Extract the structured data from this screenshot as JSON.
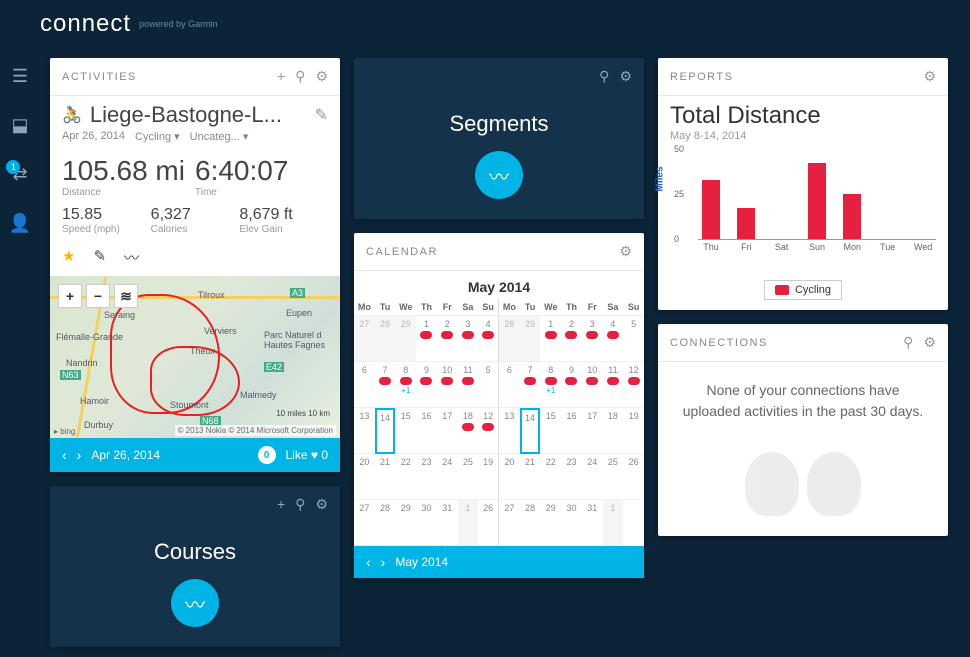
{
  "brand": {
    "name": "connect",
    "sub": "powered by Garmin"
  },
  "sidebar": {
    "notif_count": "1"
  },
  "activities": {
    "header": "ACTIVITIES",
    "title": "Liege-Bastogne-L...",
    "date": "Apr 26, 2014",
    "sport": "Cycling",
    "category": "Uncateg...",
    "distance_val": "105.68 mi",
    "distance_lbl": "Distance",
    "time_val": "6:40:07",
    "time_lbl": "Time",
    "speed_val": "15.85",
    "speed_lbl": "Speed (mph)",
    "cal_val": "6,327",
    "cal_lbl": "Calories",
    "elev_val": "8,679 ft",
    "elev_lbl": "Elev Gain",
    "map": {
      "places": [
        "Seraing",
        "Flémalle-Grande",
        "Verviers",
        "Theux",
        "Nandrin",
        "Hamoir",
        "Durbuy",
        "Stoumont",
        "Malmedy",
        "Tilroux",
        "Eupen",
        "Parc Naturel d Hautes Fagnes",
        "N63",
        "A3",
        "N68",
        "E42"
      ],
      "scale": "10 miles   10 km",
      "attr1": "© 2013 Nokia",
      "attr2": "© 2014 Microsoft Corporation",
      "bing": "bing"
    },
    "footer_date": "Apr 26, 2014",
    "footer_comments": "0",
    "footer_like": "Like",
    "footer_likes": "0"
  },
  "segments": {
    "header": "Segments"
  },
  "courses": {
    "header": "Courses"
  },
  "calendar": {
    "header": "CALENDAR",
    "title": "May 2014",
    "dayheads": [
      "Mo",
      "Tu",
      "We",
      "Th",
      "Fr",
      "Sa",
      "Su",
      "Mo",
      "Tu",
      "We",
      "Th",
      "Fr",
      "Sa",
      "Su"
    ],
    "rows": [
      [
        {
          "d": "27",
          "g": true
        },
        {
          "d": "28",
          "g": true
        },
        {
          "d": "29",
          "g": true
        },
        {
          "d": "1",
          "dot": true
        },
        {
          "d": "2",
          "dot": true
        },
        {
          "d": "3",
          "dot": true
        },
        {
          "d": "4",
          "dot": true
        },
        {
          "d": "28",
          "g": true
        },
        {
          "d": "29",
          "g": true
        },
        {
          "d": "1",
          "dot": true
        },
        {
          "d": "2",
          "dot": true
        },
        {
          "d": "3",
          "dot": true
        },
        {
          "d": "4",
          "dot": true
        }
      ],
      [
        {
          "d": "5"
        },
        {
          "d": "6"
        },
        {
          "d": "7",
          "dot": true
        },
        {
          "d": "8",
          "dot": true,
          "plus": "+1"
        },
        {
          "d": "9",
          "dot": true
        },
        {
          "d": "10",
          "dot": true
        },
        {
          "d": "11",
          "dot": true
        },
        {
          "d": "5"
        },
        {
          "d": "6"
        },
        {
          "d": "7",
          "dot": true
        },
        {
          "d": "8",
          "dot": true,
          "plus": "+1"
        },
        {
          "d": "9",
          "dot": true
        },
        {
          "d": "10",
          "dot": true
        },
        {
          "d": "11",
          "dot": true
        }
      ],
      [
        {
          "d": "12",
          "dot": true
        },
        {
          "d": "13"
        },
        {
          "d": "14",
          "today": true
        },
        {
          "d": "15"
        },
        {
          "d": "16"
        },
        {
          "d": "17"
        },
        {
          "d": "18",
          "dot": true
        },
        {
          "d": "12",
          "dot": true
        },
        {
          "d": "13"
        },
        {
          "d": "14",
          "today": true
        },
        {
          "d": "15"
        },
        {
          "d": "16"
        },
        {
          "d": "17"
        },
        {
          "d": "18"
        }
      ],
      [
        {
          "d": "19"
        },
        {
          "d": "20"
        },
        {
          "d": "21"
        },
        {
          "d": "22"
        },
        {
          "d": "23"
        },
        {
          "d": "24"
        },
        {
          "d": "25"
        },
        {
          "d": "19"
        },
        {
          "d": "20"
        },
        {
          "d": "21"
        },
        {
          "d": "22"
        },
        {
          "d": "23"
        },
        {
          "d": "24"
        },
        {
          "d": "25"
        }
      ],
      [
        {
          "d": "26"
        },
        {
          "d": "27"
        },
        {
          "d": "28"
        },
        {
          "d": "29"
        },
        {
          "d": "30"
        },
        {
          "d": "31"
        },
        {
          "d": "1",
          "g": true
        },
        {
          "d": "26"
        },
        {
          "d": "27"
        },
        {
          "d": "28"
        },
        {
          "d": "29"
        },
        {
          "d": "30"
        },
        {
          "d": "31"
        },
        {
          "d": "1",
          "g": true
        }
      ]
    ],
    "footer": "May 2014"
  },
  "reports": {
    "header": "REPORTS",
    "title": "Total Distance",
    "sub": "May 8-14, 2014",
    "ylabel": "Miles"
  },
  "chart_data": {
    "type": "bar",
    "categories": [
      "Thu",
      "Fri",
      "Sat",
      "Sun",
      "Mon",
      "Tue",
      "Wed"
    ],
    "series": [
      {
        "name": "Cycling",
        "values": [
          33,
          17,
          0,
          42,
          25,
          0,
          0
        ]
      }
    ],
    "title": "Total Distance",
    "xlabel": "",
    "ylabel": "Miles",
    "ylim": [
      0,
      50
    ],
    "ticks": [
      0,
      25,
      50
    ]
  },
  "connections": {
    "header": "CONNECTIONS",
    "body": "None of your connections have uploaded activities in the past 30 days."
  }
}
